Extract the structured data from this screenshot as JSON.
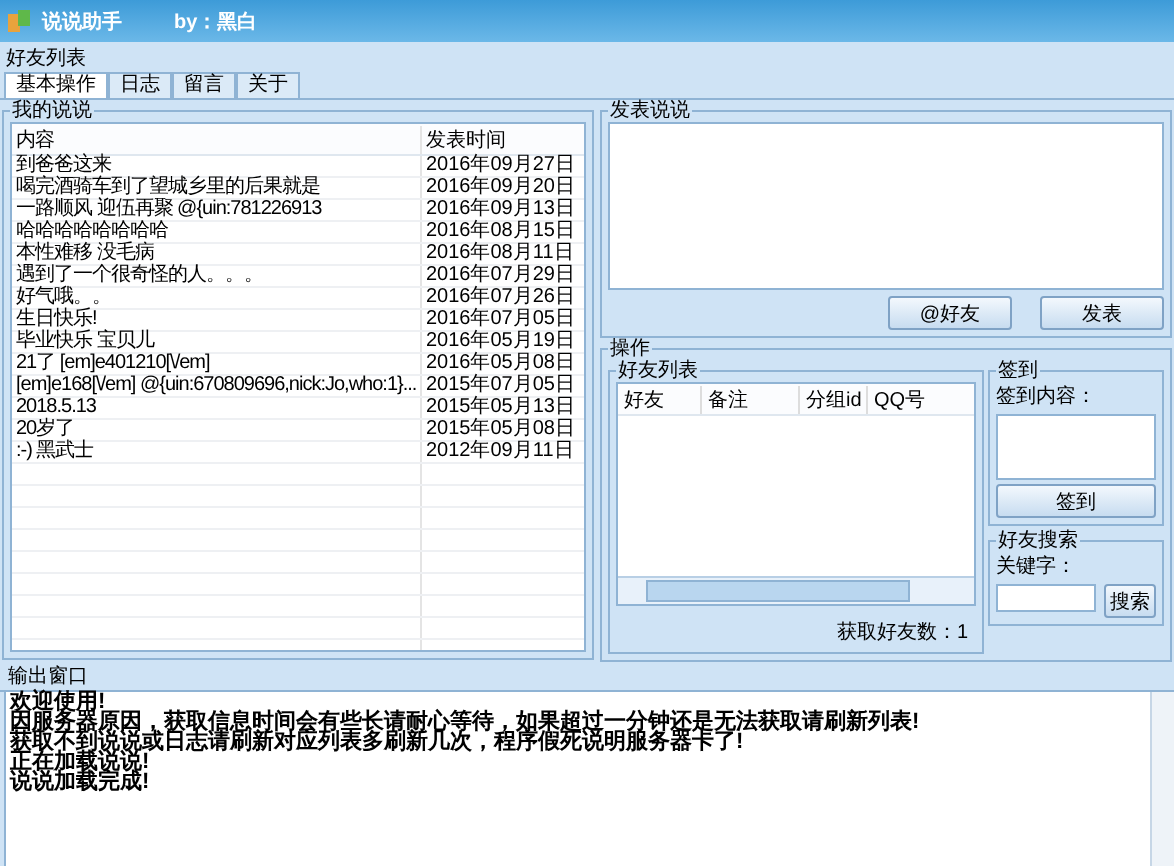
{
  "window": {
    "title": "说说助手",
    "author": "by：黑白"
  },
  "menu": [
    "好友列表"
  ],
  "tabs": [
    {
      "label": "基本操作",
      "selected": true
    },
    {
      "label": "日志",
      "selected": false
    },
    {
      "label": "留言",
      "selected": false
    },
    {
      "label": "关于",
      "selected": false
    }
  ],
  "my_posts": {
    "title": "我的说说",
    "columns": [
      "内容",
      "发表时间"
    ],
    "rows": [
      {
        "content": "到爸爸这来",
        "time": "2016年09月27日"
      },
      {
        "content": "喝完酒骑车到了望城乡里的后果就是",
        "time": "2016年09月20日"
      },
      {
        "content": "一路顺风 迎伍再聚 @{uin:781226913",
        "time": "2016年09月13日"
      },
      {
        "content": "哈哈哈哈哈哈哈哈",
        "time": "2016年08月15日"
      },
      {
        "content": "本性难移 没毛病",
        "time": "2016年08月11日"
      },
      {
        "content": "遇到了一个很奇怪的人。。。",
        "time": "2016年07月29日"
      },
      {
        "content": "好气哦。。",
        "time": "2016年07月26日"
      },
      {
        "content": "生日快乐!",
        "time": "2016年07月05日"
      },
      {
        "content": "毕业快乐 宝贝儿",
        "time": "2016年05月19日"
      },
      {
        "content": "21了 [em]e401210[\\/em]",
        "time": "2016年05月08日"
      },
      {
        "content": "[em]e168[\\/em] @{uin:670809696,nick:Jo,who:1}...",
        "time": "2015年07月05日"
      },
      {
        "content": "2018.5.13",
        "time": "2015年05月13日"
      },
      {
        "content": "20岁了",
        "time": "2015年05月08日"
      },
      {
        "content": ":-) 黑武士",
        "time": "2012年09月11日"
      }
    ]
  },
  "post": {
    "title": "发表说说",
    "buttons": [
      "@好友",
      "发表"
    ]
  },
  "operations": {
    "title": "操作",
    "friend_list": {
      "title": "好友列表",
      "columns": [
        "好友",
        "备注",
        "分组id",
        "QQ号"
      ],
      "count": "获取好友数：1"
    },
    "sign_in": {
      "title": "签到",
      "label": "签到内容：",
      "button": "签到"
    },
    "friend_search": {
      "title": "好友搜索",
      "label": "关键字：",
      "button": "搜索"
    }
  },
  "output": {
    "title": "输出窗口",
    "lines": [
      "欢迎使用!",
      "因服务器原因，获取信息时间会有些长请耐心等待，如果超过一分钟还是无法获取请刷新列表!",
      "获取不到说说或日志请刷新对应列表多刷新几次，程序假死说明服务器卡了!",
      "正在加载说说!",
      "说说加载完成!"
    ]
  }
}
